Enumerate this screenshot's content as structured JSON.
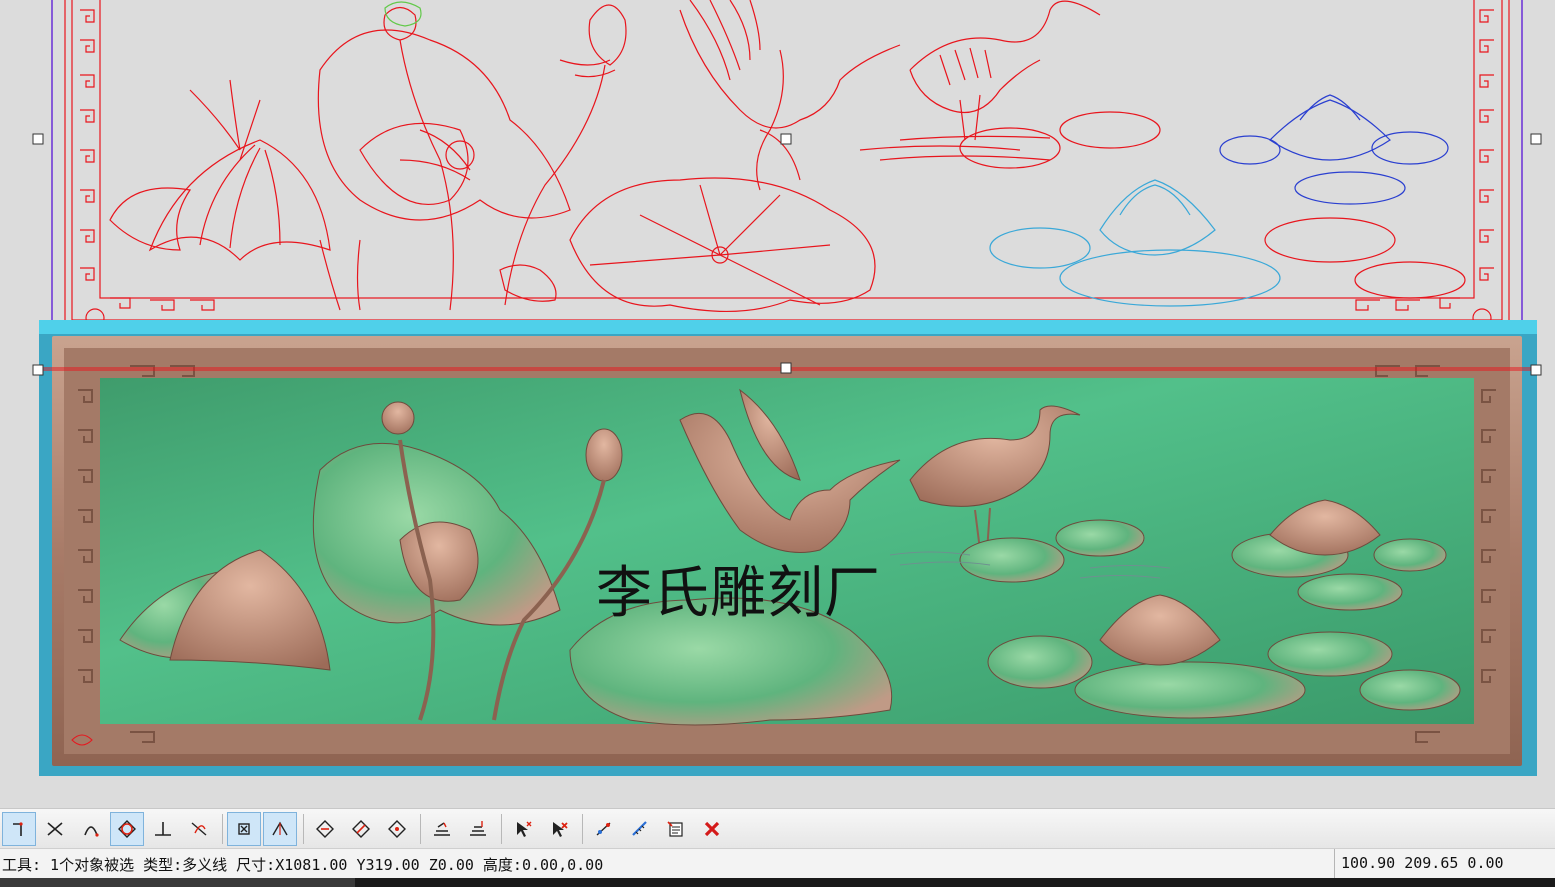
{
  "canvas": {
    "watermark_text": "李氏雕刻厂",
    "colors": {
      "background": "#dcdcdc",
      "vector_lines": "#e8151d",
      "vector_blue": "#2a3fd0",
      "vector_cyan": "#3aa8d8",
      "relief_board": "#4dba82",
      "relief_frame": "#b58a78",
      "selection_bg": "#39a7c6",
      "selection_box": "#6a2fd6"
    }
  },
  "toolbar": {
    "groups": [
      [
        {
          "icon": "corner-line-icon",
          "active": true
        },
        {
          "icon": "intersect-icon",
          "active": false
        },
        {
          "icon": "arc-icon",
          "active": false
        },
        {
          "icon": "circle-snap-icon",
          "active": true
        },
        {
          "icon": "perpendicular-icon",
          "active": false
        },
        {
          "icon": "tangent-icon",
          "active": false
        }
      ],
      [
        {
          "icon": "node-snap-icon",
          "active": true
        },
        {
          "icon": "angle-icon",
          "active": true
        }
      ],
      [
        {
          "icon": "diamond-snap-icon",
          "active": false
        },
        {
          "icon": "diamond-edit-icon",
          "active": false
        },
        {
          "icon": "diamond-point-icon",
          "active": false
        }
      ],
      [
        {
          "icon": "layer-up-icon",
          "active": false
        },
        {
          "icon": "layer-stack-icon",
          "active": false
        }
      ],
      [
        {
          "icon": "select-add-icon",
          "active": false
        },
        {
          "icon": "select-remove-icon",
          "active": false
        }
      ],
      [
        {
          "icon": "node-edit-icon",
          "active": false
        },
        {
          "icon": "measure-icon",
          "active": false
        },
        {
          "icon": "properties-icon",
          "active": false
        },
        {
          "icon": "delete-icon",
          "active": false
        }
      ]
    ]
  },
  "status": {
    "text": "工具: 1个对象被选 类型:多义线 尺寸:X1081.00 Y319.00 Z0.00 高度:0.00,0.00",
    "coordinates": "100.90 209.65 0.00"
  }
}
